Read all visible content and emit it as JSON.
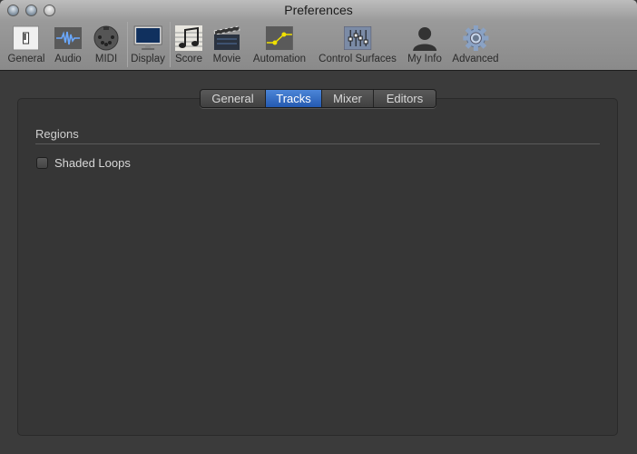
{
  "window": {
    "title": "Preferences"
  },
  "toolbar": [
    {
      "label": "General",
      "icon": "switch-icon"
    },
    {
      "label": "Audio",
      "icon": "waveform-icon"
    },
    {
      "label": "MIDI",
      "icon": "midi-plug-icon"
    },
    {
      "label": "Display",
      "icon": "monitor-icon"
    },
    {
      "label": "Score",
      "icon": "music-notes-icon"
    },
    {
      "label": "Movie",
      "icon": "clapperboard-icon"
    },
    {
      "label": "Automation",
      "icon": "automation-curve-icon"
    },
    {
      "label": "Control Surfaces",
      "icon": "faders-icon"
    },
    {
      "label": "My Info",
      "icon": "person-icon"
    },
    {
      "label": "Advanced",
      "icon": "gear-icon"
    }
  ],
  "tabs": [
    {
      "label": "General"
    },
    {
      "label": "Tracks",
      "active": true
    },
    {
      "label": "Mixer"
    },
    {
      "label": "Editors"
    }
  ],
  "content": {
    "section_title": "Regions",
    "checkbox_label": "Shaded Loops",
    "checkbox_checked": false
  }
}
